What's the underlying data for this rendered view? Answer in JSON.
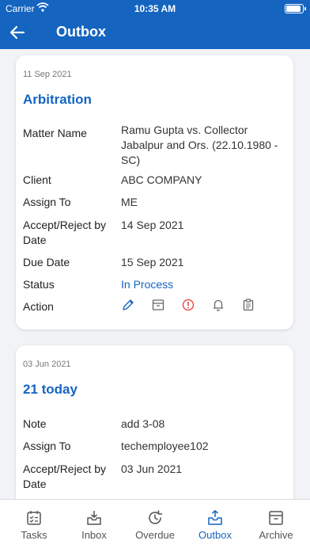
{
  "status_bar": {
    "carrier": "Carrier",
    "time": "10:35 AM"
  },
  "header": {
    "title": "Outbox"
  },
  "cards": [
    {
      "date": "11 Sep 2021",
      "title": "Arbitration",
      "rows": [
        {
          "label": "Matter Name",
          "value": "Ramu Gupta vs. Collector Jabalpur and Ors. (22.10.1980 - SC)"
        },
        {
          "label": "Client",
          "value": "ABC COMPANY"
        },
        {
          "label": "Assign To",
          "value": "ME"
        },
        {
          "label": "Accept/Reject by Date",
          "value": "14 Sep 2021"
        },
        {
          "label": "Due Date",
          "value": "15 Sep 2021"
        },
        {
          "label": "Status",
          "value": "In Process"
        },
        {
          "label": "Action",
          "value": ""
        }
      ],
      "actions": [
        "edit-icon",
        "archive-icon",
        "info-icon",
        "bell-icon",
        "clipboard-icon"
      ]
    },
    {
      "date": "03 Jun 2021",
      "title": "21 today",
      "rows": [
        {
          "label": "Note",
          "value": "add 3-08"
        },
        {
          "label": "Assign To",
          "value": "techemployee102"
        },
        {
          "label": "Accept/Reject by Date",
          "value": "03 Jun 2021"
        }
      ]
    }
  ],
  "tabs": [
    {
      "label": "Tasks",
      "icon": "tasks-icon"
    },
    {
      "label": "Inbox",
      "icon": "inbox-icon"
    },
    {
      "label": "Overdue",
      "icon": "overdue-icon"
    },
    {
      "label": "Outbox",
      "icon": "outbox-icon",
      "active": true
    },
    {
      "label": "Archive",
      "icon": "archive-icon"
    }
  ],
  "colors": {
    "primary": "#1565c0",
    "alert": "#e53935",
    "background": "#f2f3f7"
  }
}
